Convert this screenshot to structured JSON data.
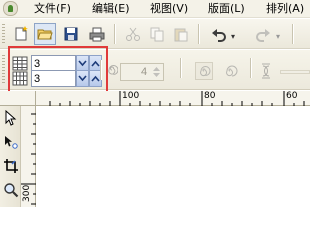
{
  "menu": {
    "items": [
      {
        "label": "文件(F)"
      },
      {
        "label": "编辑(E)"
      },
      {
        "label": "视图(V)"
      },
      {
        "label": "版面(L)"
      },
      {
        "label": "排列(A)"
      }
    ]
  },
  "toolbar": {
    "buttons": [
      "new-icon",
      "open-icon",
      "save-icon",
      "print-icon",
      "cut-icon",
      "copy-icon",
      "paste-icon",
      "undo-icon",
      "redo-icon"
    ]
  },
  "property_bar": {
    "grid_rows": {
      "value": "3"
    },
    "grid_columns": {
      "value": "3"
    },
    "spiral_revolutions": {
      "value": "4"
    }
  },
  "ruler": {
    "top_labels": [
      "100",
      "80",
      "60"
    ],
    "left_labels": [
      "300"
    ]
  },
  "colors": {
    "highlight": "#e03a3a",
    "spin_button": "#b6c8ea",
    "toolbar_bg": "#ebe8db"
  }
}
